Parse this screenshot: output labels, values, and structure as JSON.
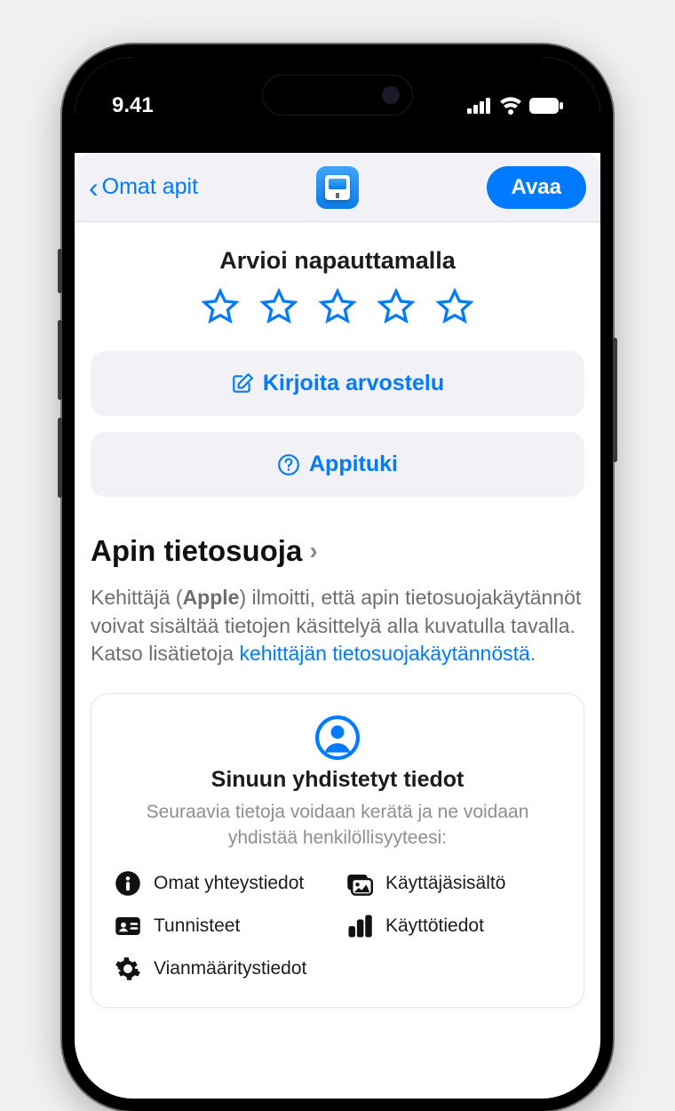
{
  "status": {
    "time": "9.41"
  },
  "nav": {
    "back_label": "Omat apit",
    "open_label": "Avaa"
  },
  "rating": {
    "title": "Arvioi napauttamalla"
  },
  "buttons": {
    "write_review": "Kirjoita arvostelu",
    "app_support": "Appituki"
  },
  "privacy": {
    "heading": "Apin tietosuoja",
    "text_pre": "Kehittäjä (",
    "developer": "Apple",
    "text_mid": ") ilmoitti, että apin tietosuojakäytännöt voivat sisältää tietojen käsittelyä alla kuvatulla tavalla. Katso lisätietoja ",
    "link": "kehittäjän tietosuojakäytännöstä",
    "text_end": "."
  },
  "card": {
    "title": "Sinuun yhdistetyt tiedot",
    "sub": "Seuraavia tietoja voidaan kerätä ja ne voidaan yhdistää henkilöllisyyteesi:"
  },
  "data_types": {
    "contact_info": "Omat yhteystiedot",
    "user_content": "Käyttäjäsisältö",
    "identifiers": "Tunnisteet",
    "usage_data": "Käyttötiedot",
    "diagnostics": "Vianmääritystiedot"
  }
}
